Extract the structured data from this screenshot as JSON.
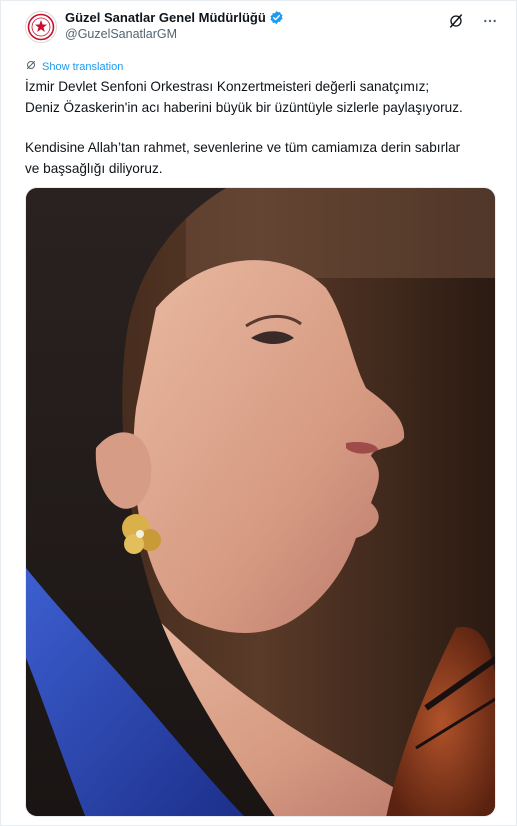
{
  "author": {
    "display_name": "Güzel Sanatlar Genel Müdürlüğü",
    "handle": "@GuzelSanatlarGM",
    "verified": true,
    "avatar_icon": "ministry-seal-icon"
  },
  "header_actions": {
    "grok_icon": "grok-icon",
    "more_icon": "more-icon"
  },
  "translation": {
    "label": "Show translation",
    "icon": "translate-icon"
  },
  "tweet": {
    "lines": [
      "İzmir Devlet Senfoni Orkestrası  Konzertmeisteri değerli sanatçımız;",
      "Deniz Özaskerin'in acı haberini büyük bir üzüntüyle sizlerle paylaşıyoruz.",
      "Kendisine Allah’tan rahmet, sevenlerine ve tüm camiamıza derin sabırlar",
      "ve başsağlığı diliyoruz."
    ]
  },
  "colors": {
    "accent": "#1d9bf0",
    "text": "#0f1419",
    "secondary": "#536471",
    "seal_red": "#c8102e"
  }
}
